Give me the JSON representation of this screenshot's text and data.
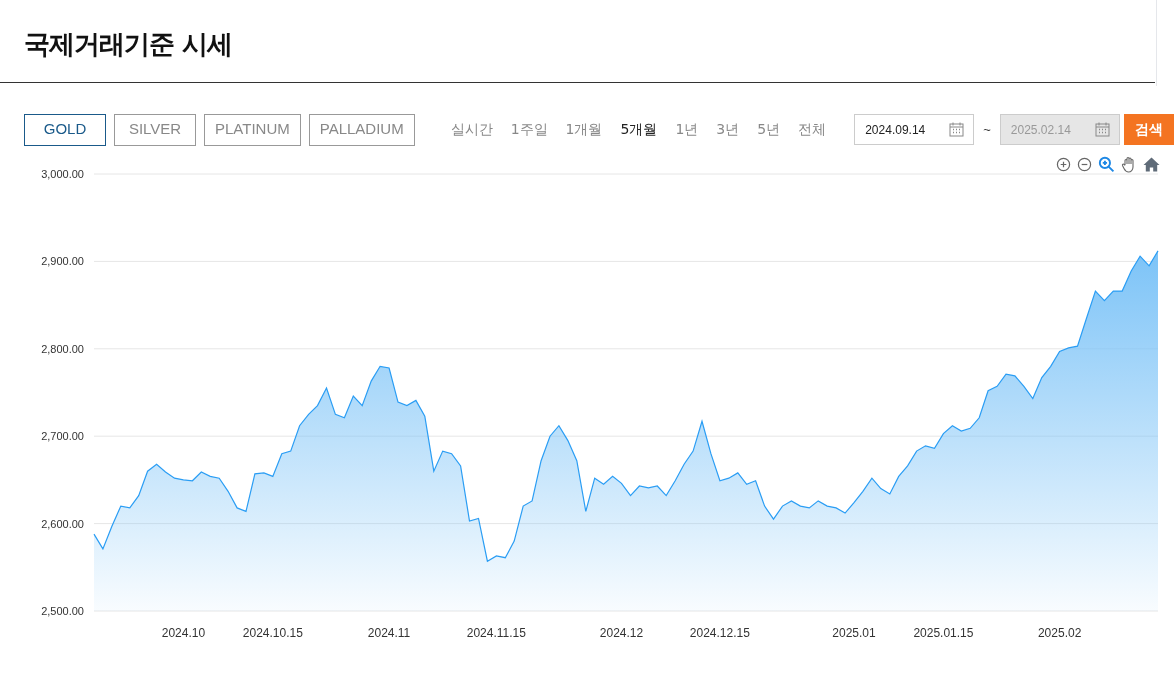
{
  "title": "국제거래기준 시세",
  "metals": [
    {
      "label": "GOLD",
      "selected": true
    },
    {
      "label": "SILVER",
      "selected": false
    },
    {
      "label": "PLATINUM",
      "selected": false
    },
    {
      "label": "PALLADIUM",
      "selected": false
    }
  ],
  "periods": [
    {
      "label": "실시간",
      "selected": false
    },
    {
      "label": "1주일",
      "selected": false
    },
    {
      "label": "1개월",
      "selected": false
    },
    {
      "label": "5개월",
      "selected": true
    },
    {
      "label": "1년",
      "selected": false
    },
    {
      "label": "3년",
      "selected": false
    },
    {
      "label": "5년",
      "selected": false
    },
    {
      "label": "전체",
      "selected": false
    }
  ],
  "date_from": {
    "value": "2024.09.14",
    "disabled": false
  },
  "separator": "~",
  "date_to": {
    "value": "2025.02.14",
    "disabled": true
  },
  "search_button": "검색",
  "chart": {
    "chart_data": {
      "type": "area",
      "grid": true,
      "ylim": [
        2500,
        3000
      ],
      "yticks": [
        {
          "value": 2500,
          "label": "2,500.00"
        },
        {
          "value": 2600,
          "label": "2,600.00"
        },
        {
          "value": 2700,
          "label": "2,700.00"
        },
        {
          "value": 2800,
          "label": "2,800.00"
        },
        {
          "value": 2900,
          "label": "2,900.00"
        },
        {
          "value": 3000,
          "label": "3,000.00"
        }
      ],
      "categories": [
        null,
        null,
        null,
        null,
        null,
        null,
        null,
        null,
        null,
        null,
        "2024.10",
        null,
        null,
        null,
        null,
        null,
        null,
        null,
        null,
        null,
        "2024.10.15",
        null,
        null,
        null,
        null,
        null,
        null,
        null,
        null,
        null,
        null,
        null,
        null,
        "2024.11",
        null,
        null,
        null,
        null,
        null,
        null,
        null,
        null,
        null,
        null,
        null,
        "2024.11.15",
        null,
        null,
        null,
        null,
        null,
        null,
        null,
        null,
        null,
        null,
        null,
        null,
        null,
        "2024.12",
        null,
        null,
        null,
        null,
        null,
        null,
        null,
        null,
        null,
        null,
        "2024.12.15",
        null,
        null,
        null,
        null,
        null,
        null,
        null,
        null,
        null,
        null,
        null,
        null,
        null,
        null,
        "2025.01",
        null,
        null,
        null,
        null,
        null,
        null,
        null,
        null,
        null,
        "2025.01.15",
        null,
        null,
        null,
        null,
        null,
        null,
        null,
        null,
        null,
        null,
        null,
        null,
        "2025.02",
        null,
        null,
        null,
        null,
        null,
        null,
        null,
        null,
        null,
        null,
        null
      ],
      "series": [
        {
          "color": "#2a9df4",
          "values": [
            2588,
            2571,
            2597,
            2620,
            2618,
            2632,
            2660,
            2668,
            2659,
            2652,
            2650,
            2649,
            2659,
            2654,
            2652,
            2637,
            2618,
            2614,
            2657,
            2658,
            2654,
            2680,
            2683,
            2712,
            2725,
            2735,
            2755,
            2725,
            2721,
            2746,
            2735,
            2763,
            2780,
            2778,
            2739,
            2735,
            2741,
            2723,
            2660,
            2683,
            2680,
            2666,
            2603,
            2606,
            2557,
            2563,
            2561,
            2580,
            2620,
            2626,
            2672,
            2700,
            2712,
            2695,
            2672,
            2614,
            2652,
            2645,
            2654,
            2646,
            2632,
            2643,
            2641,
            2643,
            2632,
            2649,
            2668,
            2683,
            2717,
            2680,
            2649,
            2652,
            2658,
            2645,
            2649,
            2620,
            2605,
            2620,
            2626,
            2620,
            2618,
            2626,
            2620,
            2618,
            2612,
            2624,
            2637,
            2652,
            2640,
            2634,
            2654,
            2666,
            2683,
            2689,
            2686,
            2703,
            2712,
            2706,
            2709,
            2721,
            2752,
            2757,
            2771,
            2769,
            2757,
            2743,
            2767,
            2780,
            2797,
            2801,
            2803,
            2835,
            2866,
            2855,
            2866,
            2866,
            2889,
            2906,
            2895,
            2912
          ]
        }
      ]
    }
  }
}
